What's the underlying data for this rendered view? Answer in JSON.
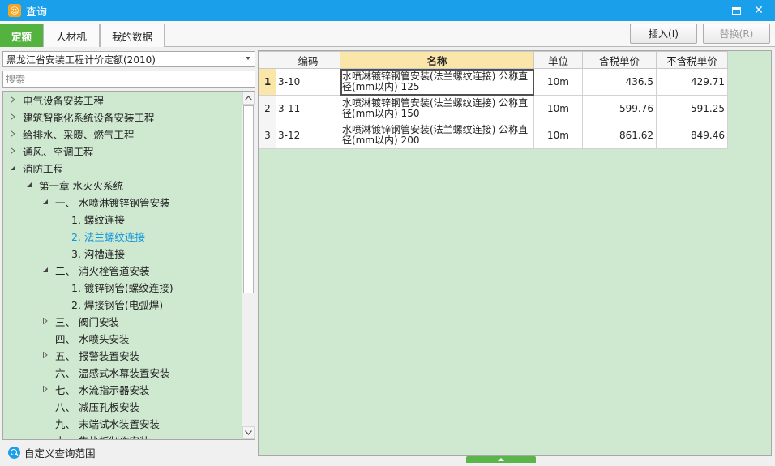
{
  "window": {
    "title": "查询",
    "close_glyph": "✕"
  },
  "tabs": [
    {
      "label": "定额",
      "active": true
    },
    {
      "label": "人材机",
      "active": false
    },
    {
      "label": "我的数据",
      "active": false
    }
  ],
  "toolbar": {
    "insert_label": "插入(I)",
    "replace_label": "替换(R)"
  },
  "left_panel": {
    "quota_select_value": "黑龙江省安装工程计价定额(2010)",
    "search_placeholder": "搜索",
    "tree": [
      {
        "label": "电气设备安装工程",
        "level": 0,
        "toggle": "closed"
      },
      {
        "label": "建筑智能化系统设备安装工程",
        "level": 0,
        "toggle": "closed"
      },
      {
        "label": "给排水、采暖、燃气工程",
        "level": 0,
        "toggle": "closed"
      },
      {
        "label": "通风、空调工程",
        "level": 0,
        "toggle": "closed"
      },
      {
        "label": "消防工程",
        "level": 0,
        "toggle": "open"
      },
      {
        "label": "第一章 水灭火系统",
        "level": 1,
        "toggle": "open"
      },
      {
        "label": "一、 水喷淋镀锌钢管安装",
        "level": 2,
        "toggle": "open"
      },
      {
        "label": "1. 螺纹连接",
        "level": 3,
        "toggle": "none"
      },
      {
        "label": "2. 法兰螺纹连接",
        "level": 3,
        "toggle": "none",
        "selected": true
      },
      {
        "label": "3. 沟槽连接",
        "level": 3,
        "toggle": "none"
      },
      {
        "label": "二、 消火栓管道安装",
        "level": 2,
        "toggle": "open"
      },
      {
        "label": "1. 镀锌钢管(螺纹连接)",
        "level": 3,
        "toggle": "none"
      },
      {
        "label": "2. 焊接钢管(电弧焊)",
        "level": 3,
        "toggle": "none"
      },
      {
        "label": "三、 阀门安装",
        "level": 2,
        "toggle": "closed"
      },
      {
        "label": "四、 水喷头安装",
        "level": 2,
        "toggle": "none"
      },
      {
        "label": "五、 报警装置安装",
        "level": 2,
        "toggle": "closed"
      },
      {
        "label": "六、 温感式水幕装置安装",
        "level": 2,
        "toggle": "none"
      },
      {
        "label": "七、 水流指示器安装",
        "level": 2,
        "toggle": "closed"
      },
      {
        "label": "八、 减压孔板安装",
        "level": 2,
        "toggle": "none"
      },
      {
        "label": "九、 末端试水装置安装",
        "level": 2,
        "toggle": "none"
      },
      {
        "label": "十、 集热板制作安装",
        "level": 2,
        "toggle": "none"
      }
    ],
    "custom_scope_label": "自定义查询范围"
  },
  "grid": {
    "columns": [
      "",
      "编码",
      "名称",
      "单位",
      "含税单价",
      "不含税单价"
    ],
    "rows": [
      {
        "index": "1",
        "code": "3-10",
        "name": "水喷淋镀锌钢管安装(法兰螺纹连接) 公称直径(mm以内) 125",
        "unit": "10m",
        "price_tax": "436.5",
        "price_notax": "429.71",
        "current": true
      },
      {
        "index": "2",
        "code": "3-11",
        "name": "水喷淋镀锌钢管安装(法兰螺纹连接) 公称直径(mm以内) 150",
        "unit": "10m",
        "price_tax": "599.76",
        "price_notax": "591.25",
        "current": false
      },
      {
        "index": "3",
        "code": "3-12",
        "name": "水喷淋镀锌钢管安装(法兰螺纹连接) 公称直径(mm以内) 200",
        "unit": "10m",
        "price_tax": "861.62",
        "price_notax": "849.46",
        "current": false
      }
    ]
  },
  "colors": {
    "titlebar": "#1a9fea",
    "active_tab": "#54b33f",
    "panel_bg": "#cfe8d0",
    "selected_text": "#1296db",
    "sorted_header": "#fbe6a9"
  }
}
